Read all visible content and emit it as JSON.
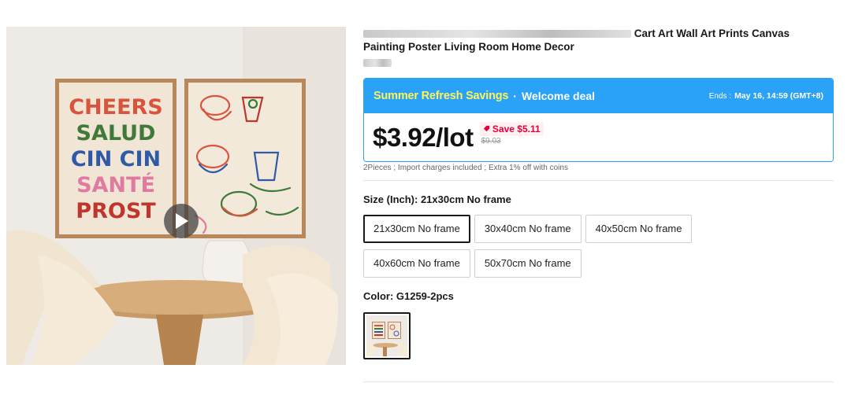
{
  "product": {
    "title_line1": "Cart Art Wall Art Prints Canvas",
    "title_line2": "Painting Poster Living Room Home Decor"
  },
  "image": {
    "poster_words": [
      "CHEERS",
      "SALUD",
      "CIN CIN",
      "SANTÉ",
      "PROST"
    ],
    "poster_colors": [
      "#d9543c",
      "#3f7a3a",
      "#2f5aa8",
      "#e07aa0",
      "#c0362c"
    ]
  },
  "deal": {
    "promo_name": "Summer Refresh Savings",
    "separator": "·",
    "deal_type": "Welcome deal",
    "ends_label": "Ends :",
    "ends_value": "May 16, 14:59 (GMT+8)",
    "price": "$3.92/lot",
    "save": "Save $5.11",
    "original_price": "$9.03",
    "accent": "#2aa2f7",
    "save_color": "#e5003a"
  },
  "note": "2Pieces ; Import charges included ; Extra 1% off with coins",
  "size": {
    "label": "Size (Inch): 21x30cm No frame",
    "options": [
      "21x30cm No frame",
      "30x40cm No frame",
      "40x50cm No frame",
      "40x60cm No frame",
      "50x70cm No frame"
    ],
    "selected": "21x30cm No frame"
  },
  "color": {
    "label": "Color: G1259-2pcs"
  },
  "icons": {
    "play": "play-icon",
    "save": "save-tag-icon"
  }
}
